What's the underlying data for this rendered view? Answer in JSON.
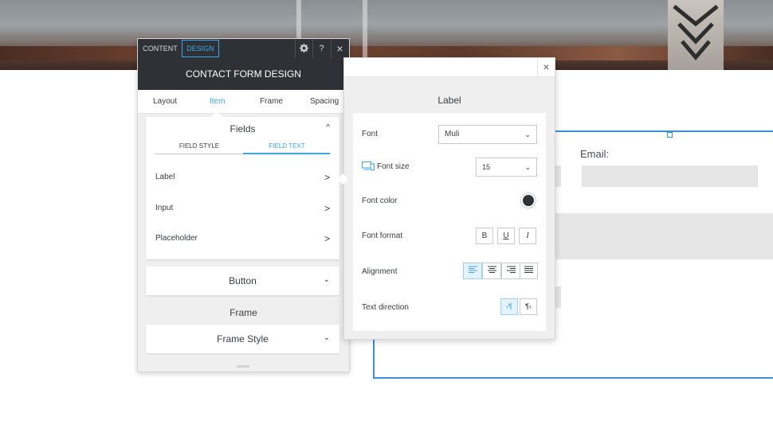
{
  "panel": {
    "tabs": {
      "content": "CONTENT",
      "design": "DESIGN"
    },
    "icons": {
      "settings": "gear-icon",
      "help": "?",
      "close": "×"
    },
    "title": "CONTACT FORM DESIGN",
    "subtabs": [
      "Layout",
      "Item",
      "Frame",
      "Spacing"
    ],
    "fields_card": {
      "title": "Fields",
      "chevron": "^",
      "field_tabs": [
        "FIELD STYLE",
        "FIELD TEXT"
      ],
      "rows": [
        "Label",
        "Input",
        "Placeholder"
      ],
      "row_arrow": ">"
    },
    "button_card": {
      "title": "Button",
      "chevron": "⌄"
    },
    "frame_section": "Frame",
    "frame_style_card": {
      "title": "Frame Style",
      "chevron": "⌄"
    }
  },
  "page": {
    "email_label": "Email:"
  },
  "popup": {
    "close": "×",
    "title": "Label",
    "font_label": "Font",
    "font_value": "Muli",
    "font_size_label": "Font size",
    "font_size_value": "15",
    "font_color_label": "Font color",
    "font_color": "#2e3236",
    "font_format_label": "Font format",
    "format_buttons": [
      "B",
      "U",
      "I"
    ],
    "alignment_label": "Alignment",
    "alignment_buttons": [
      "≡",
      "≡",
      "≡",
      "≡"
    ],
    "text_direction_label": "Text direction",
    "direction_buttons": [
      "¶",
      "¶"
    ]
  },
  "colors": {
    "accent": "#3ea6e8",
    "dark": "#2e3236",
    "frame": "#3b8ed8"
  }
}
